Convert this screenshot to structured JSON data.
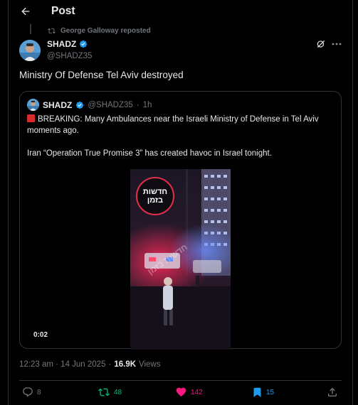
{
  "header": {
    "title": "Post"
  },
  "repost": {
    "text": "George Galloway reposted"
  },
  "author": {
    "name": "SHADZ",
    "handle": "@SHADZ35"
  },
  "post": {
    "text": "Ministry Of Defense Tel Aviv destroyed"
  },
  "quote": {
    "name": "SHADZ",
    "handle": "@SHADZ35",
    "dot": "·",
    "time": "1h",
    "line1": "BREAKING: Many Ambulances near the Israeli Ministry of Defense in Tel Aviv moments ago.",
    "line2": "Iran “Operation True Promise 3” has created havoc in Israel tonight.",
    "video": {
      "duration": "0:02",
      "logo_line1": "חדשות",
      "logo_line2": "בזמן",
      "watermark": "חדשות בזמן"
    }
  },
  "meta": {
    "timestamp": "12:23 am · 14 Jun 2025",
    "dot": "·",
    "views_count": "16.9K",
    "views_label": "Views"
  },
  "actions": {
    "replies": "8",
    "reposts": "48",
    "likes": "142",
    "bookmarks": "15"
  },
  "colors": {
    "repost": "#00ba7c",
    "like": "#f91880",
    "bookmark": "#1d9bf0",
    "verified": "#1d9bf0",
    "muted": "#71767b"
  }
}
